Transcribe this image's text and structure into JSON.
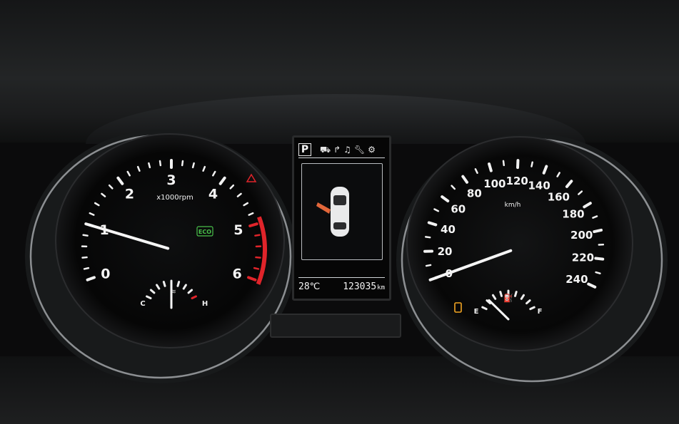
{
  "tachometer": {
    "ticks": [
      "0",
      "1",
      "2",
      "3",
      "4",
      "5",
      "6"
    ],
    "unit": "x1000rpm",
    "value_krpm": 1.0,
    "eco_label": "ECO",
    "eco_color": "#49c04a",
    "redline_color": "#e0242a"
  },
  "temp_gauge": {
    "low_label": "C",
    "high_label": "H",
    "value_fraction": 0.5
  },
  "lcd": {
    "gear": "P",
    "icons": [
      "truck-icon",
      "arrow-turn-icon",
      "music-note-icon",
      "wrench-icon",
      "gear-icon"
    ],
    "outside_temp": "28℃",
    "odometer": "123035",
    "odometer_unit": "km",
    "door_open_color": "#e2673a"
  },
  "speedometer": {
    "ticks": [
      "0",
      "20",
      "40",
      "60",
      "80",
      "100",
      "120",
      "140",
      "160",
      "180",
      "200",
      "220",
      "240"
    ],
    "unit": "km/h",
    "value_kmh": 0
  },
  "fuel_gauge": {
    "empty_label": "E",
    "full_label": "F",
    "value_fraction": 0.15,
    "warning_color": "#f3a623"
  }
}
